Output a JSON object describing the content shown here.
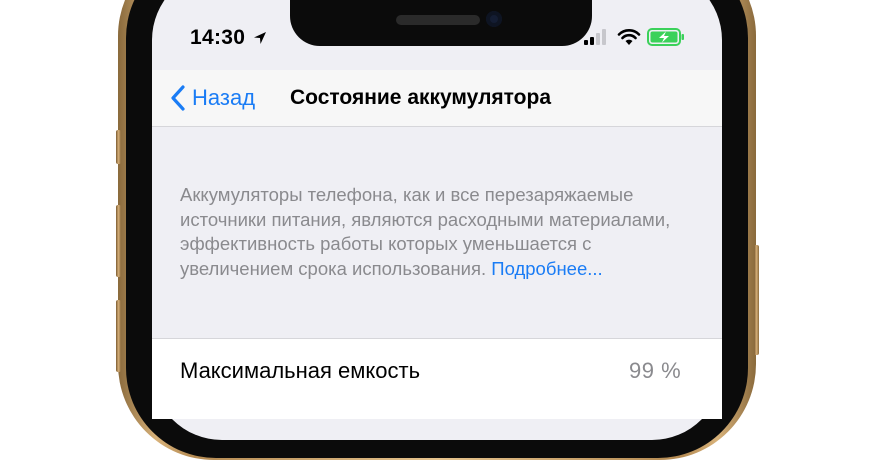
{
  "status_bar": {
    "time": "14:30",
    "icons": [
      "location-arrow-icon",
      "cellular-signal-icon",
      "wifi-icon",
      "battery-charging-icon"
    ]
  },
  "nav": {
    "back_label": "Назад",
    "title": "Состояние аккумулятора"
  },
  "description": {
    "text": "Аккумуляторы телефона, как и все перезаряжаемые источники питания, являются расходными материалами, эффективность работы которых уменьшается с увеличением срока использования. ",
    "link_label": "Подробнее..."
  },
  "capacity_cell": {
    "label": "Максимальная емкость",
    "value": "99 %"
  },
  "colors": {
    "accent": "#1a7cf5",
    "battery_green": "#3bd15a",
    "background": "#efeff4",
    "secondary_text": "#8a8a8e",
    "frame_gold": "#d8b27a"
  }
}
